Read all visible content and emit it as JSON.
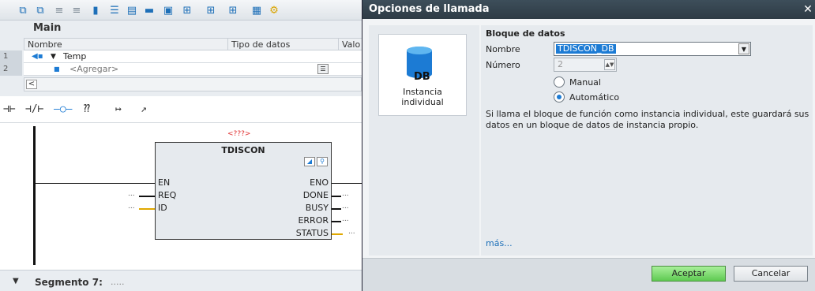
{
  "editor": {
    "block_title": "Main",
    "columns": [
      "Nombre",
      "Tipo de datos",
      "Valo"
    ],
    "rows": [
      {
        "num": "1",
        "name": "Temp"
      },
      {
        "num": "2",
        "name": "<Agregar>"
      }
    ],
    "scroll_left": "<",
    "ladder_tools": [
      "⊣⊢",
      "⊣/⊢",
      "–○–",
      "⁇",
      "↦",
      "↗"
    ],
    "block": {
      "instance": "<???>",
      "name": "TDISCON",
      "inputs": [
        "EN",
        "REQ",
        "ID"
      ],
      "outputs": [
        "ENO",
        "DONE",
        "BUSY",
        "ERROR",
        "STATUS"
      ],
      "dots": "..."
    },
    "segment_label": "Segmento 7:",
    "segment_comment": "....."
  },
  "dialog": {
    "title": "Opciones de llamada",
    "close": "✕",
    "instance_card": {
      "db_label": "DB",
      "label_line1": "Instancia",
      "label_line2": "individual"
    },
    "group_title": "Bloque de datos",
    "name_label": "Nombre",
    "name_value": "TDISCON_DB",
    "number_label": "Número",
    "number_value": "2",
    "radio_manual": "Manual",
    "radio_auto": "Automático",
    "description": "Si llama el bloque de función como instancia individual, este guardará sus datos en un bloque de datos de instancia propio.",
    "more_link": "más...",
    "ok_label": "Aceptar",
    "cancel_label": "Cancelar"
  },
  "colors": {
    "accent": "#1c7bd4",
    "ok_green": "#5fca52",
    "dialog_dark": "#3b4a55"
  }
}
